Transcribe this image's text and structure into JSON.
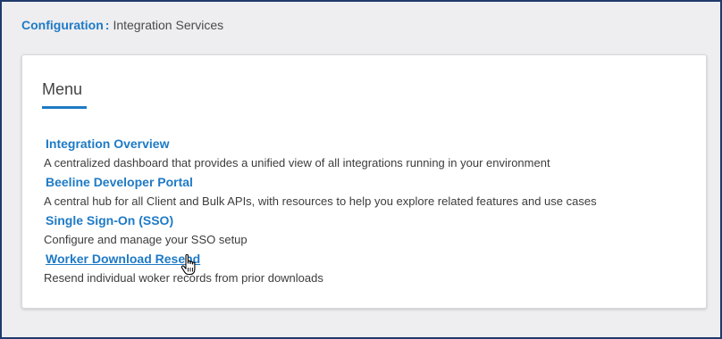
{
  "breadcrumb": {
    "parent_label": "Configuration",
    "separator": ":",
    "current_label": "Integration Services"
  },
  "menu": {
    "title": "Menu",
    "accent_color": "#1e7ac6",
    "items": [
      {
        "label": "Integration Overview",
        "description": "A centralized dashboard that provides a unified view of all integrations running in your environment"
      },
      {
        "label": "Beeline Developer Portal",
        "description": "A central hub for all Client and Bulk APIs, with resources to help you explore related features and use cases"
      },
      {
        "label": "Single Sign-On (SSO)",
        "description": "Configure and manage your SSO setup"
      },
      {
        "label": "Worker Download Resend",
        "description": "Resend individual woker records from prior downloads"
      }
    ]
  },
  "cursor": {
    "icon": "hand-pointer-icon"
  }
}
